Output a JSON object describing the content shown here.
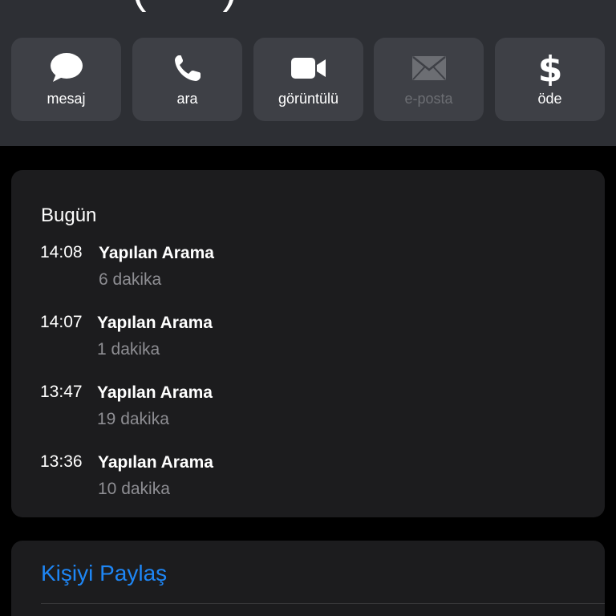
{
  "header": {
    "contact_name_partial": "( )"
  },
  "actions": [
    {
      "label": "mesaj",
      "icon": "message-bubble-icon",
      "disabled": false
    },
    {
      "label": "ara",
      "icon": "phone-icon",
      "disabled": false
    },
    {
      "label": "görüntülü",
      "icon": "video-camera-icon",
      "disabled": false
    },
    {
      "label": "e-posta",
      "icon": "envelope-icon",
      "disabled": true
    },
    {
      "label": "öde",
      "icon": "dollar-icon",
      "disabled": false
    }
  ],
  "recent_calls": {
    "title": "Bugün",
    "items": [
      {
        "time": "14:08",
        "type": "Yapılan Arama",
        "duration": "6 dakika"
      },
      {
        "time": "14:07",
        "type": "Yapılan Arama",
        "duration": "1 dakika"
      },
      {
        "time": "13:47",
        "type": "Yapılan Arama",
        "duration": "19 dakika"
      },
      {
        "time": "13:36",
        "type": "Yapılan Arama",
        "duration": "10 dakika"
      }
    ]
  },
  "share_contact": {
    "label": "Kişiyi Paylaş"
  },
  "colors": {
    "background": "#000000",
    "header_bg": "#2d2f34",
    "button_bg": "#3e4046",
    "card_bg": "#1c1c1e",
    "secondary_text": "#8e8e93",
    "link_blue": "#1e86f5",
    "disabled_text": "#6c6e73"
  }
}
